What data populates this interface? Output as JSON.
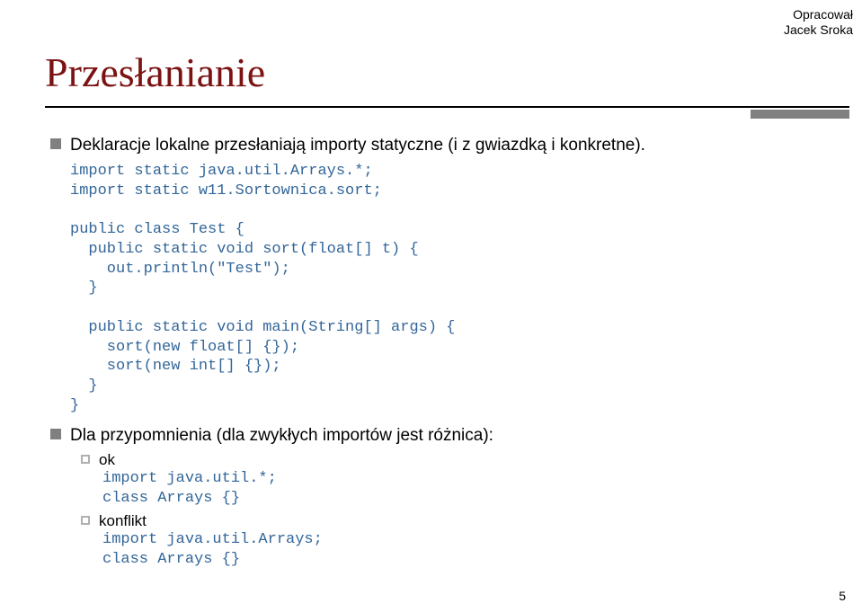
{
  "author": {
    "line1": "Opracował",
    "line2": "Jacek Sroka"
  },
  "title": "Przesłanianie",
  "bullet1": "Deklaracje lokalne przesłaniają importy statyczne (i z gwiazdką i konkretne).",
  "code1": "import static java.util.Arrays.*;\nimport static w11.Sortownica.sort;\n\npublic class Test {\n  public static void sort(float[] t) {\n    out.println(\"Test\");\n  }\n\n  public static void main(String[] args) {\n    sort(new float[] {});\n    sort(new int[] {});\n  }\n}",
  "bullet2": "Dla przypomnienia (dla zwykłych importów jest różnica):",
  "sub1_label": "ok",
  "sub1_code": "import java.util.*;\nclass Arrays {}",
  "sub2_label": "konflikt",
  "sub2_code": "import java.util.Arrays;\nclass Arrays {}",
  "page": "5"
}
